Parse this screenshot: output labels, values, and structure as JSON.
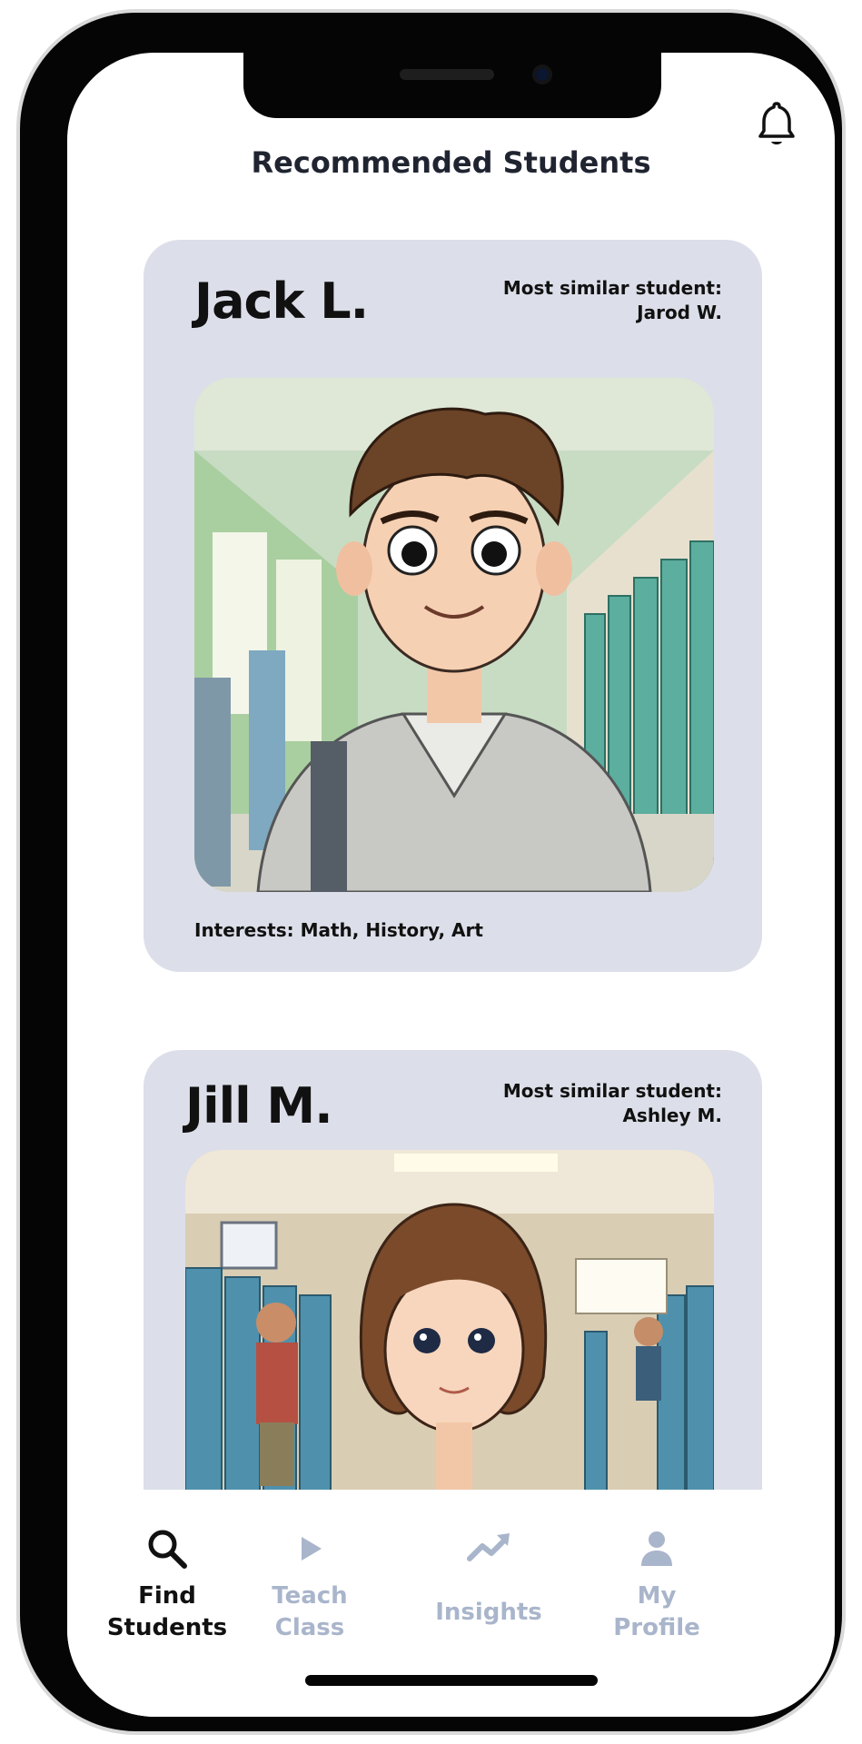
{
  "header": {
    "title": "Recommended Students",
    "notification_icon": "bell-icon"
  },
  "students": [
    {
      "name": "Jack L.",
      "similar_label": "Most similar student:",
      "similar_name": "Jarod W.",
      "interests": "Interests: Math, History, Art"
    },
    {
      "name": "Jill M.",
      "similar_label": "Most similar student:",
      "similar_name": "Ashley M.",
      "interests": ""
    }
  ],
  "nav": [
    {
      "line1": "Find",
      "line2": "Students",
      "icon": "search-icon",
      "active": true
    },
    {
      "line1": "Teach",
      "line2": "Class",
      "icon": "play-icon",
      "active": false
    },
    {
      "line1": "Insights",
      "line2": "",
      "icon": "trend-icon",
      "active": false
    },
    {
      "line1": "My",
      "line2": "Profile",
      "icon": "user-icon",
      "active": false
    }
  ],
  "colors": {
    "card_bg": "#dcdfe9",
    "active_nav": "#111111",
    "inactive_nav": "#a9b5cb"
  }
}
